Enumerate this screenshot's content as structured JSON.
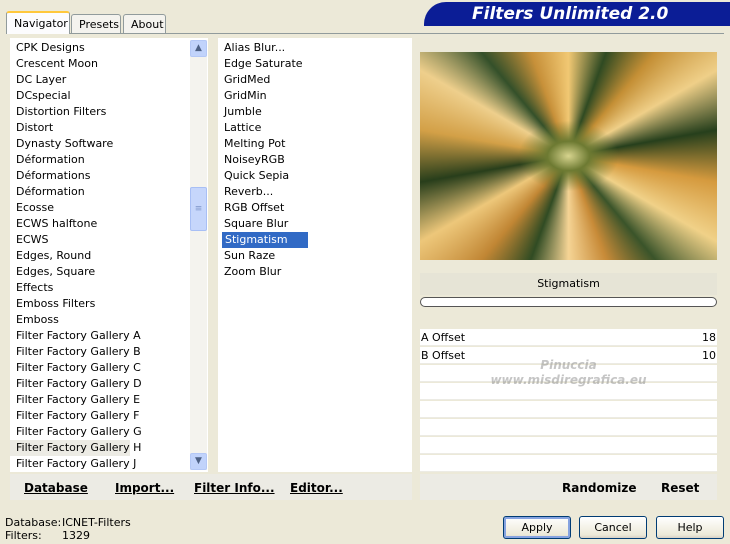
{
  "app_title": "Filters Unlimited 2.0",
  "tabs": [
    {
      "label": "Navigator",
      "active": true
    },
    {
      "label": "Presets",
      "active": false
    },
    {
      "label": "About",
      "active": false
    }
  ],
  "categories": [
    "CPK Designs",
    "Crescent Moon",
    "DC Layer",
    "DCspecial",
    "Distortion Filters",
    "Distort",
    "Dynasty Software",
    "Déformation",
    "Déformations",
    "Déformation",
    "Ecosse",
    "ECWS halftone",
    "ECWS",
    "Edges, Round",
    "Edges, Square",
    "Effects",
    "Emboss Filters",
    "Emboss",
    "Filter Factory Gallery A",
    "Filter Factory Gallery B",
    "Filter Factory Gallery C",
    "Filter Factory Gallery D",
    "Filter Factory Gallery E",
    "Filter Factory Gallery F",
    "Filter Factory Gallery G",
    "Filter Factory Gallery H",
    "Filter Factory Gallery J"
  ],
  "selected_category": "Filter Factory Gallery H",
  "filters": [
    "Alias Blur...",
    "Edge Saturate",
    "GridMed",
    "GridMin",
    "Jumble",
    "Lattice",
    "Melting Pot",
    "NoiseyRGB",
    "Quick Sepia",
    "Reverb...",
    "RGB Offset",
    "Square Blur",
    "Stigmatism",
    "Sun Raze",
    "Zoom Blur"
  ],
  "selected_filter": "Stigmatism",
  "current_filter_name": "Stigmatism",
  "progress": 0,
  "params": [
    {
      "label": "A Offset",
      "value": "18"
    },
    {
      "label": "B Offset",
      "value": "10"
    }
  ],
  "watermark": {
    "line1": "Pinuccia",
    "line2": "www.misdiregrafica.eu"
  },
  "toolbar": {
    "database": "Database",
    "import": "Import...",
    "filter_info": "Filter Info...",
    "editor": "Editor...",
    "randomize": "Randomize",
    "reset": "Reset"
  },
  "status": {
    "database_label": "Database:",
    "database_value": "ICNET-Filters",
    "filters_label": "Filters:",
    "filters_value": "1329"
  },
  "buttons": {
    "apply": "Apply",
    "cancel": "Cancel",
    "help": "Help"
  },
  "colors": {
    "banner": "#0b1d96",
    "selection": "#316ac5",
    "tab_accent": "#ffc83c"
  }
}
